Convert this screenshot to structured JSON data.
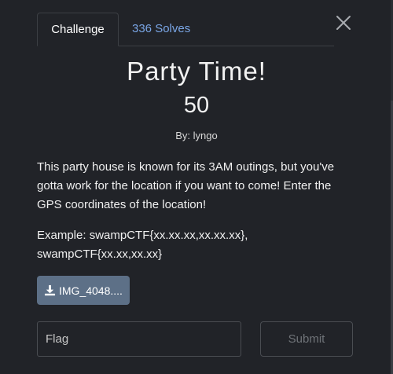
{
  "tabs": {
    "challenge_label": "Challenge",
    "solves_label": "336 Solves"
  },
  "challenge": {
    "title": "Party Time!",
    "points": "50",
    "author": "By: lyngo",
    "description": "This party house is known for its 3AM outings, but you've gotta work for the location if you want to come! Enter the GPS coordinates of the location!",
    "example": "Example: swampCTF{xx.xx.xx,xx.xx.xx}, swampCTF{xx.xx,xx.xx}"
  },
  "file": {
    "label": "IMG_4048....",
    "icon": "download-icon"
  },
  "flag_input": {
    "placeholder": "Flag",
    "value": ""
  },
  "submit": {
    "label": "Submit"
  },
  "colors": {
    "background": "#212328",
    "accent_link": "#7aa6e6",
    "file_button": "#5d7087",
    "border": "#4a4d52"
  }
}
